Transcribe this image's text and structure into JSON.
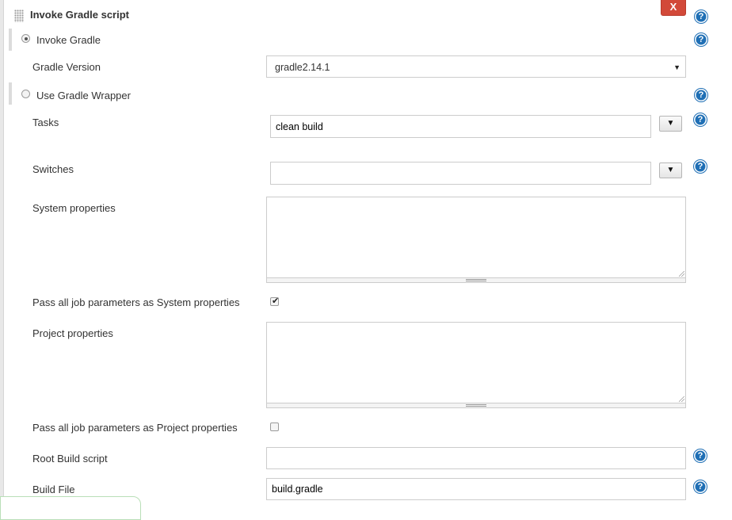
{
  "section": {
    "title": "Invoke Gradle script",
    "delete_label": "X"
  },
  "help_icon_glyph": "?",
  "invoke_gradle": {
    "label": "Invoke Gradle",
    "selected": true
  },
  "gradle_version": {
    "label": "Gradle Version",
    "value": "gradle2.14.1",
    "caret": "▼"
  },
  "use_wrapper": {
    "label": "Use Gradle Wrapper",
    "selected": false
  },
  "tasks": {
    "label": "Tasks",
    "value": "clean build",
    "dropdown_glyph": "▼"
  },
  "switches": {
    "label": "Switches",
    "value": "",
    "dropdown_glyph": "▼"
  },
  "system_properties": {
    "label": "System properties",
    "value": ""
  },
  "pass_system": {
    "label": "Pass all job parameters as System properties",
    "checked": true,
    "check_glyph": "✔"
  },
  "project_properties": {
    "label": "Project properties",
    "value": ""
  },
  "pass_project": {
    "label": "Pass all job parameters as Project properties",
    "checked": false
  },
  "root_build_script": {
    "label": "Root Build script",
    "value": ""
  },
  "build_file": {
    "label": "Build File",
    "value": "build.gradle"
  },
  "colors": {
    "delete_button": "#d24939",
    "help_icon": "#1f6fb5"
  }
}
